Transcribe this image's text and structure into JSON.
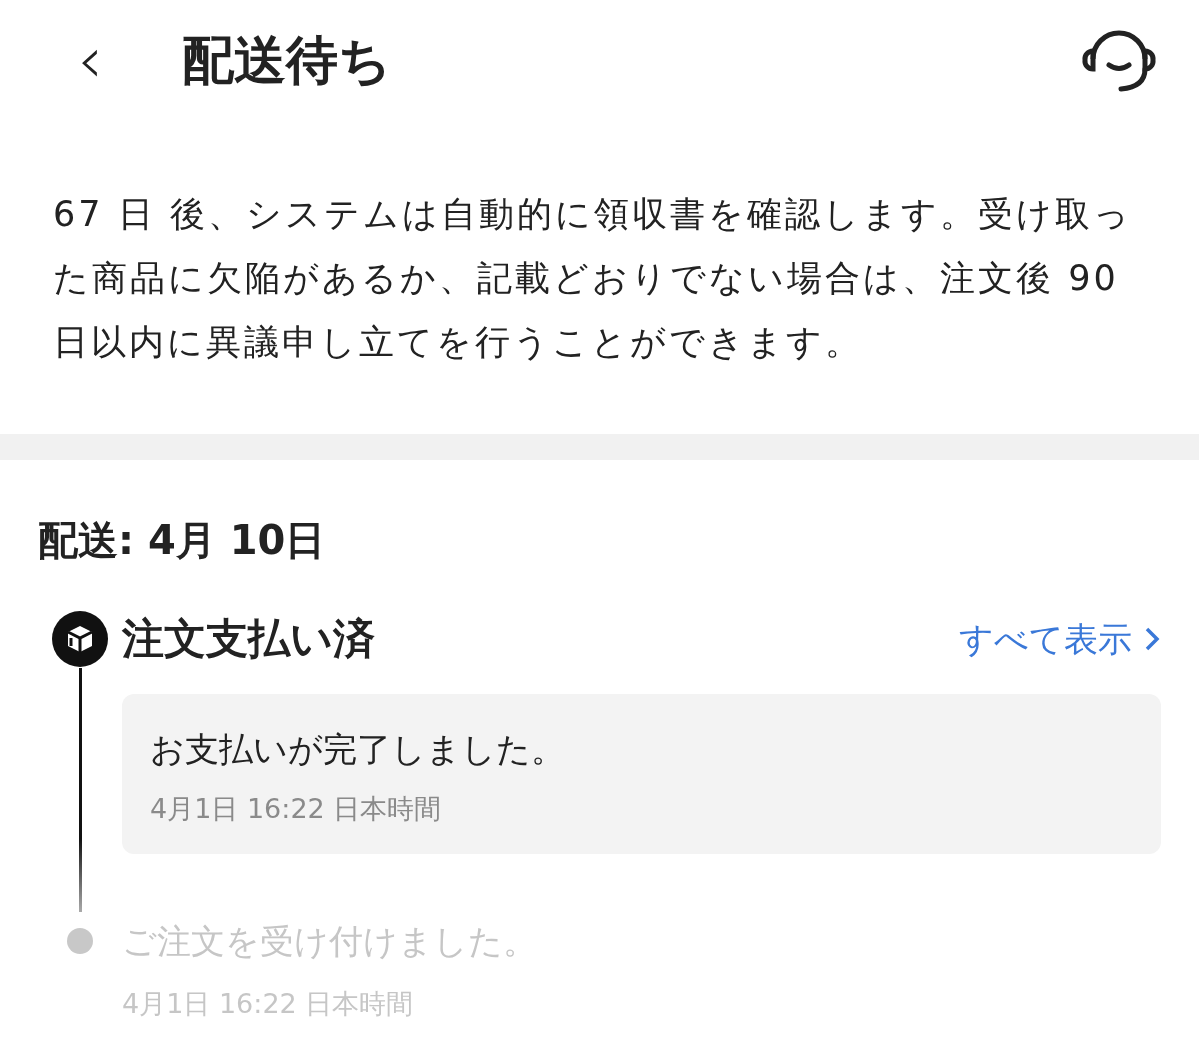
{
  "header": {
    "back": "‹",
    "title": "配送待ち"
  },
  "notice": "67 日 後、システムは自動的に領収書を確認します。受け取った商品に欠陥があるか、記載どおりでない場合は、注文後 90 日以内に異議申し立てを行うことができます。",
  "delivery": "配送: 4月 10日",
  "timeline": [
    {
      "title": "注文支払い済",
      "link": "すべて表示",
      "active": true,
      "events": [
        {
          "text": "お支払いが完了しました。",
          "time": "4月1日 16:22 日本時間"
        }
      ]
    },
    {
      "title": "ご注文を受け付けました。",
      "time": "4月1日 16:22 日本時間",
      "active": false
    }
  ]
}
